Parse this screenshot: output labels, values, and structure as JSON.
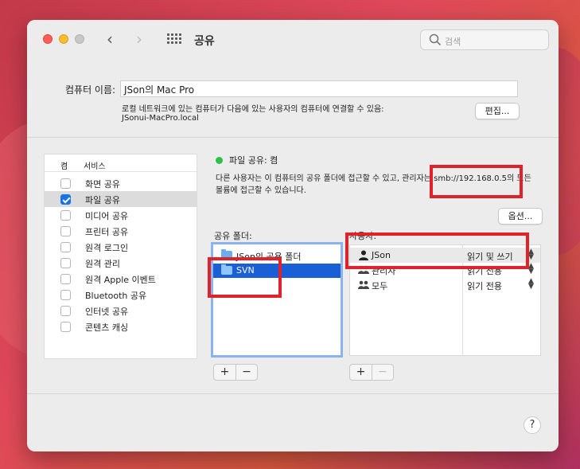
{
  "window": {
    "title": "공유",
    "search_placeholder": "검색"
  },
  "computer_name": {
    "label": "컴퓨터 이름:",
    "value": "JSon의 Mac Pro",
    "local_desc": "로컬 네트워크에 있는 컴퓨터가 다음에 있는 사용자의 컴퓨터에 연결할 수 있음:",
    "local_host": "JSonui-MacPro.local",
    "edit_button": "편집..."
  },
  "services": {
    "col_on": "켬",
    "col_service": "서비스",
    "items": [
      {
        "label": "화면 공유",
        "checked": false
      },
      {
        "label": "파일 공유",
        "checked": true
      },
      {
        "label": "미디어 공유",
        "checked": false
      },
      {
        "label": "프린터 공유",
        "checked": false
      },
      {
        "label": "원격 로그인",
        "checked": false
      },
      {
        "label": "원격 관리",
        "checked": false
      },
      {
        "label": "원격 Apple 이벤트",
        "checked": false
      },
      {
        "label": "Bluetooth 공유",
        "checked": false
      },
      {
        "label": "인터넷 공유",
        "checked": false
      },
      {
        "label": "콘텐츠 캐싱",
        "checked": false
      }
    ]
  },
  "detail": {
    "status": "파일 공유: 켬",
    "status_color": "#30c04a",
    "desc_line1": "다른 사용자는 이 컴퓨터의 공유 폴더에 접근할 수 있고, 관리자는 smb://192.168.0.5의 모든",
    "desc_line2": "볼륨에 접근할 수 있습니다.",
    "options_button": "옵션...",
    "shared_folders_label": "공유 폴더:",
    "users_label": "사용자:",
    "folders": [
      {
        "name": "JSon의 공용 폴더",
        "selected": false
      },
      {
        "name": "SVN",
        "selected": true
      }
    ],
    "users": [
      {
        "name": "JSon",
        "permission": "읽기 및 쓰기",
        "icon": "person-icon"
      },
      {
        "name": "관리자",
        "permission": "읽기 전용",
        "icon": "group-icon"
      },
      {
        "name": "모두",
        "permission": "읽기 전용",
        "icon": "group-icon"
      }
    ]
  },
  "controls": {
    "plus": "+",
    "minus": "−",
    "help": "?"
  },
  "accent": "#1a5fd6"
}
